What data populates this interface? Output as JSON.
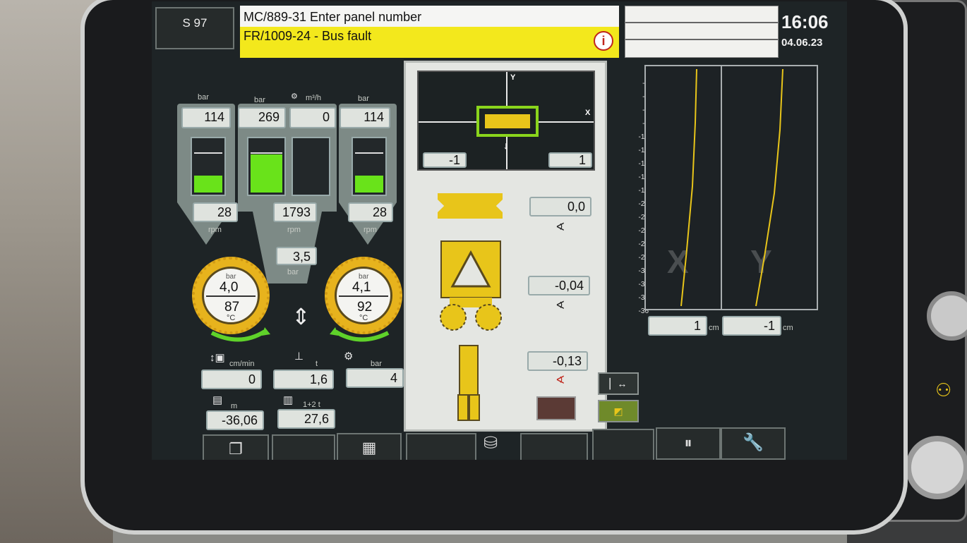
{
  "header": {
    "station": "S 97",
    "message1": "MC/889-31 Enter panel number",
    "message2": "FR/1009-24  - Bus fault",
    "time": "16:06",
    "date": "04.06.23"
  },
  "left_panel": {
    "unit_bar": "bar",
    "unit_flow": "m³/h",
    "unit_rpm": "rpm",
    "pressure_left": "114",
    "pressure_mid": "269",
    "flow": "0",
    "pressure_right": "114",
    "rpm_left": "28",
    "rpm_mid": "1793",
    "rpm_right": "28",
    "mid_bar_value": "3,5",
    "cutter_left": {
      "pressure": "4,0",
      "temp": "87",
      "unit_p": "bar",
      "unit_t": "°C"
    },
    "cutter_right": {
      "pressure": "4,1",
      "temp": "92",
      "unit_p": "bar",
      "unit_t": "°C"
    },
    "speed_unit": "cm/min",
    "speed": "0",
    "load_unit": "t",
    "load": "1,6",
    "pump_unit": "bar",
    "pump": "4",
    "depth_unit": "m",
    "depth": "-36,06",
    "weight_label": "1+2 t",
    "weight": "27,6"
  },
  "center_panel": {
    "axis_y": "Y",
    "axis_x": "X",
    "x_left": "-1",
    "x_right": "1",
    "angle1": "0,0",
    "angle2": "-0,04",
    "angle3": "-0,13"
  },
  "right_panel": {
    "scale": [
      "0",
      "-2",
      "-4",
      "-6",
      "-8",
      "-10",
      "-12",
      "-14",
      "-16",
      "-18",
      "-20",
      "-22",
      "-24",
      "-26",
      "-28",
      "-30",
      "-32",
      "-34",
      "-36"
    ],
    "label_x": "X",
    "label_y": "Y",
    "value_x": "1",
    "value_y": "-1",
    "unit": "cm"
  },
  "colors": {
    "accent_yellow": "#e8c51a",
    "level_green": "#69e31a",
    "alarm_yellow": "#f3e81c"
  },
  "icons": [
    "pages-icon",
    "grid-icon",
    "database-icon",
    "pause-icon",
    "wrench-icon",
    "sensor-icon",
    "cutter-icon"
  ]
}
